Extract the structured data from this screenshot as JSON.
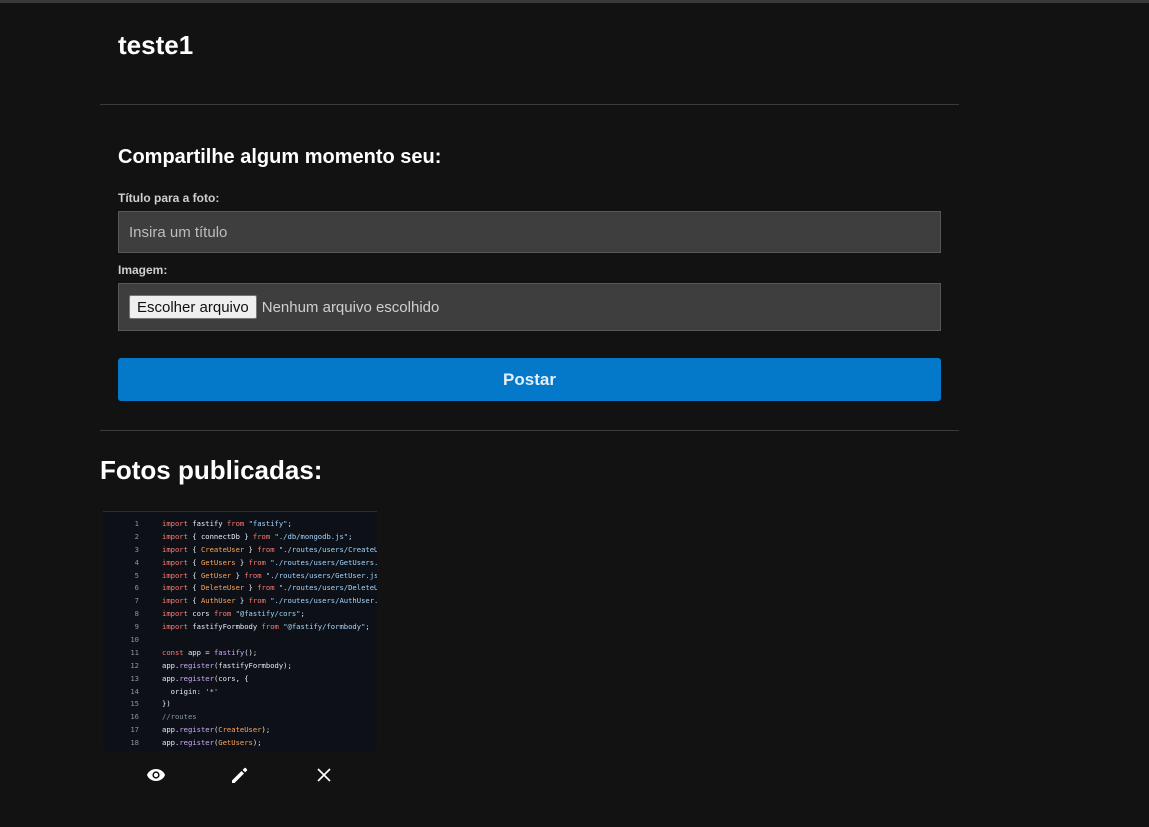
{
  "header": {
    "username": "teste1"
  },
  "form": {
    "title": "Compartilhe algum momento seu:",
    "title_label": "Título para a foto:",
    "title_placeholder": "Insira um título",
    "image_label": "Imagem:",
    "file_button": "Escolher arquivo",
    "file_status": "Nenhum arquivo escolhido",
    "submit_label": "Postar",
    "accent_color": "#0579c9"
  },
  "gallery": {
    "title": "Fotos publicadas:",
    "photos": [
      {
        "code_lines": [
          {
            "n": "1",
            "text": "import fastify from \"fastify\";"
          },
          {
            "n": "2",
            "text": "import { connectDb } from \"./db/mongodb.js\";"
          },
          {
            "n": "3",
            "text": "import { CreateUser } from \"./routes/users/CreateUs"
          },
          {
            "n": "4",
            "text": "import { GetUsers } from \"./routes/users/GetUsers.j"
          },
          {
            "n": "5",
            "text": "import { GetUser } from \"./routes/users/GetUser.js\""
          },
          {
            "n": "6",
            "text": "import { DeleteUser } from \"./routes/users/DeleteUs"
          },
          {
            "n": "7",
            "text": "import { AuthUser } from \"./routes/users/AuthUser.j"
          },
          {
            "n": "8",
            "text": "import cors from \"@fastify/cors\";"
          },
          {
            "n": "9",
            "text": "import fastifyFormbody from \"@fastify/formbody\";"
          },
          {
            "n": "10",
            "text": ""
          },
          {
            "n": "11",
            "text": "const app = fastify();"
          },
          {
            "n": "12",
            "text": "app.register(fastifyFormbody);"
          },
          {
            "n": "13",
            "text": "app.register(cors, {"
          },
          {
            "n": "14",
            "text": "  origin: '*'"
          },
          {
            "n": "15",
            "text": "})"
          },
          {
            "n": "16",
            "text": "//routes"
          },
          {
            "n": "17",
            "text": "app.register(CreateUser);"
          },
          {
            "n": "18",
            "text": "app.register(GetUsers);"
          }
        ],
        "actions": [
          {
            "name": "view",
            "icon": "eye-icon"
          },
          {
            "name": "edit",
            "icon": "pencil-icon"
          },
          {
            "name": "delete",
            "icon": "close-icon"
          }
        ]
      }
    ]
  }
}
